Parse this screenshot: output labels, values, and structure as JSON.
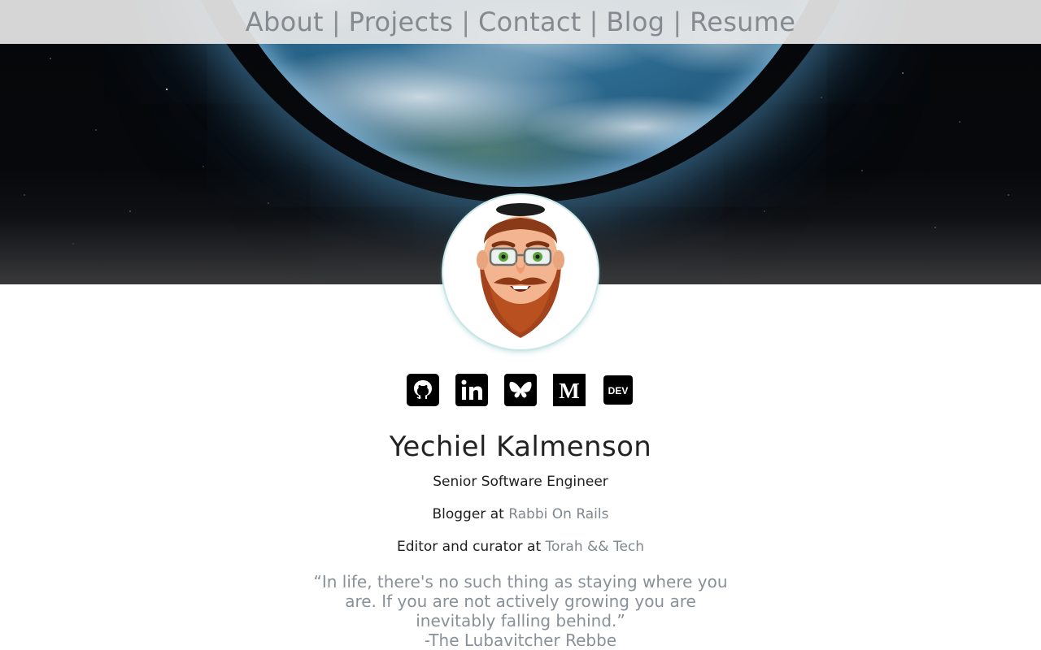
{
  "nav": {
    "items": [
      {
        "label": "About"
      },
      {
        "label": "Projects"
      },
      {
        "label": "Contact"
      },
      {
        "label": "Blog"
      },
      {
        "label": "Resume"
      }
    ],
    "separator": "|"
  },
  "socials": [
    {
      "icon": "github-icon"
    },
    {
      "icon": "linkedin-icon"
    },
    {
      "icon": "bluesky-icon"
    },
    {
      "icon": "medium-icon",
      "glyph": "M"
    },
    {
      "icon": "dev-icon",
      "glyph": "DEV"
    }
  ],
  "profile": {
    "name": "Yechiel Kalmenson",
    "title": "Senior Software Engineer",
    "blogger_prefix": "Blogger at ",
    "blog_link": "Rabbi On Rails",
    "editor_prefix": "Editor and curator at ",
    "editor_link": "Torah && Tech"
  },
  "quote": {
    "text": "“In life, there's no such thing as staying where you are. If you are not actively growing you are inevitably falling behind.”",
    "attribution": "-The Lubavitcher Rebbe"
  },
  "colors": {
    "nav_bg": "#e8e8e8",
    "link": "#80878e",
    "text": "#1e1e1e",
    "avatar_ring": "#c9e6e6"
  }
}
